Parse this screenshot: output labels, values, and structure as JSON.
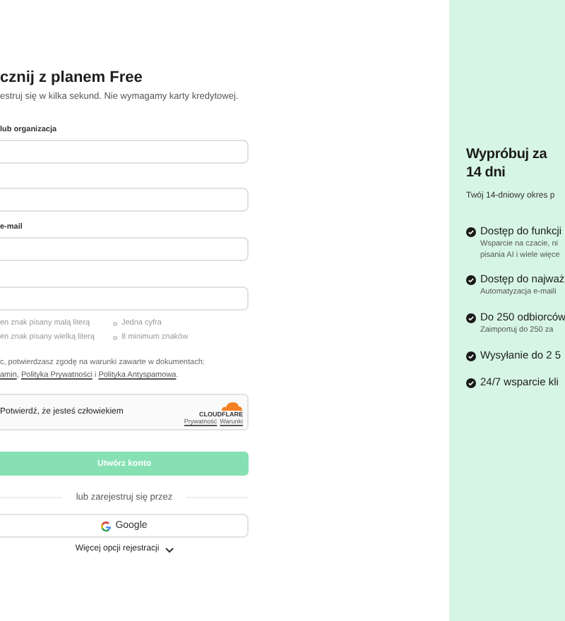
{
  "signup": {
    "title": "cznij z planem Free",
    "subtitle": "estruj się w kilka sekund. Nie wymagamy karty kredytowej.",
    "fields": [
      {
        "kind": "text",
        "label": "lub organizacja"
      },
      {
        "kind": "text"
      },
      {
        "kind": "text",
        "label": "e-mail"
      },
      {
        "kind": "text"
      }
    ],
    "password_hints": [
      [
        "en znak pisany małą literą",
        "Jedna cyfra"
      ],
      [
        "en znak pisany wielką literą",
        "8 minimum znaków"
      ]
    ],
    "consent": [
      {
        "kind": "text",
        "text": "c, potwierdzasz zgodę na warunki zawarte w dokumentach:"
      },
      {
        "kind": "break"
      },
      {
        "kind": "link",
        "text": "amin"
      },
      {
        "kind": "text",
        "text": ", "
      },
      {
        "kind": "link",
        "text": "Polityka Prywatności"
      },
      {
        "kind": "text",
        "text": " i "
      },
      {
        "kind": "link",
        "text": "Polityka Antyspamowa"
      },
      {
        "kind": "text",
        "text": "."
      }
    ],
    "captcha": {
      "label": "Potwierdź, że jesteś człowiekiem",
      "brand": "CLOUDFLARE",
      "links": [
        "Prywatność",
        "Warunki"
      ]
    },
    "submit": {
      "label": "Utwórz konto",
      "disabled": true
    },
    "divider": "lub zarejestruj się przez",
    "google": "Google",
    "more": "Więcej opcji rejestracji"
  },
  "trial": {
    "title": [
      "Wypróbuj za",
      "14 dni"
    ],
    "subtitle": "Twój 14-dniowy okres p",
    "features": [
      {
        "title": "Dostęp do funkcji",
        "details": [
          "Wsparcie na czacie, ni",
          "pisania AI i wiele więce"
        ]
      },
      {
        "title": "Dostęp do najważ",
        "details": [
          "Automatyzacja e-maili"
        ]
      },
      {
        "title": "Do 250 odbiorców",
        "details": [
          "Zaimportuj do 250 za"
        ]
      },
      {
        "title": "Wysyłanie do 2 5"
      },
      {
        "title": "24/7 wsparcie kli"
      }
    ]
  }
}
